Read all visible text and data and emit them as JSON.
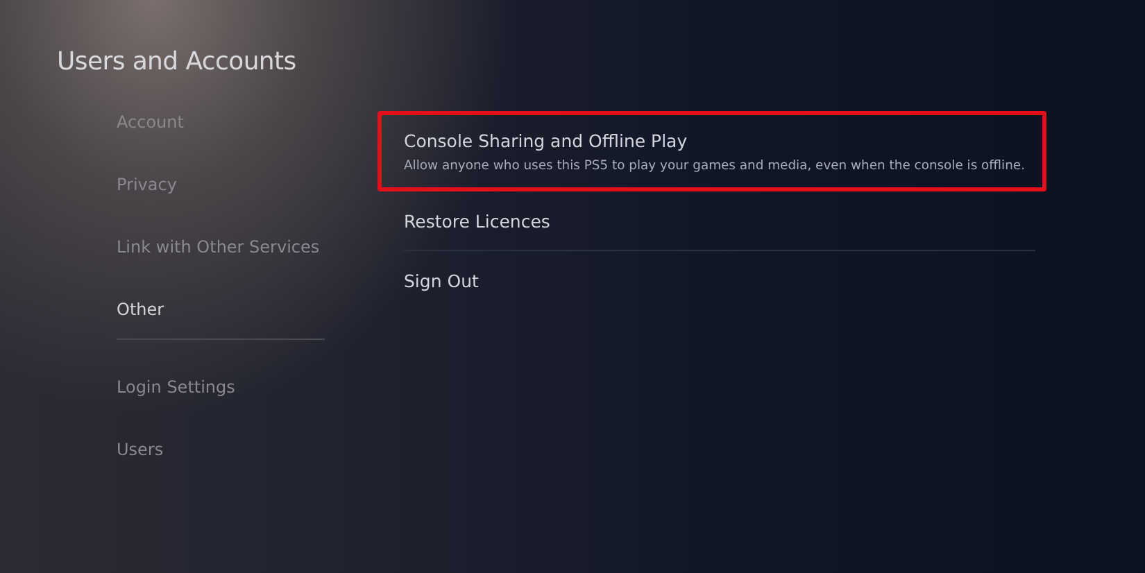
{
  "title": "Users and Accounts",
  "sidebar": {
    "items": [
      {
        "label": "Account",
        "selected": false,
        "divider_after": false
      },
      {
        "label": "Privacy",
        "selected": false,
        "divider_after": false
      },
      {
        "label": "Link with Other Services",
        "selected": false,
        "divider_after": false
      },
      {
        "label": "Other",
        "selected": true,
        "divider_after": true
      },
      {
        "label": "Login Settings",
        "selected": false,
        "divider_after": false
      },
      {
        "label": "Users",
        "selected": false,
        "divider_after": false
      }
    ]
  },
  "options": [
    {
      "label": "Console Sharing and Offline Play",
      "description": "Allow anyone who uses this PS5 to play your games and media, even when the console is offline.",
      "highlighted": true
    },
    {
      "label": "Restore Licences",
      "highlighted": false
    },
    {
      "label": "Sign Out",
      "highlighted": false
    }
  ]
}
